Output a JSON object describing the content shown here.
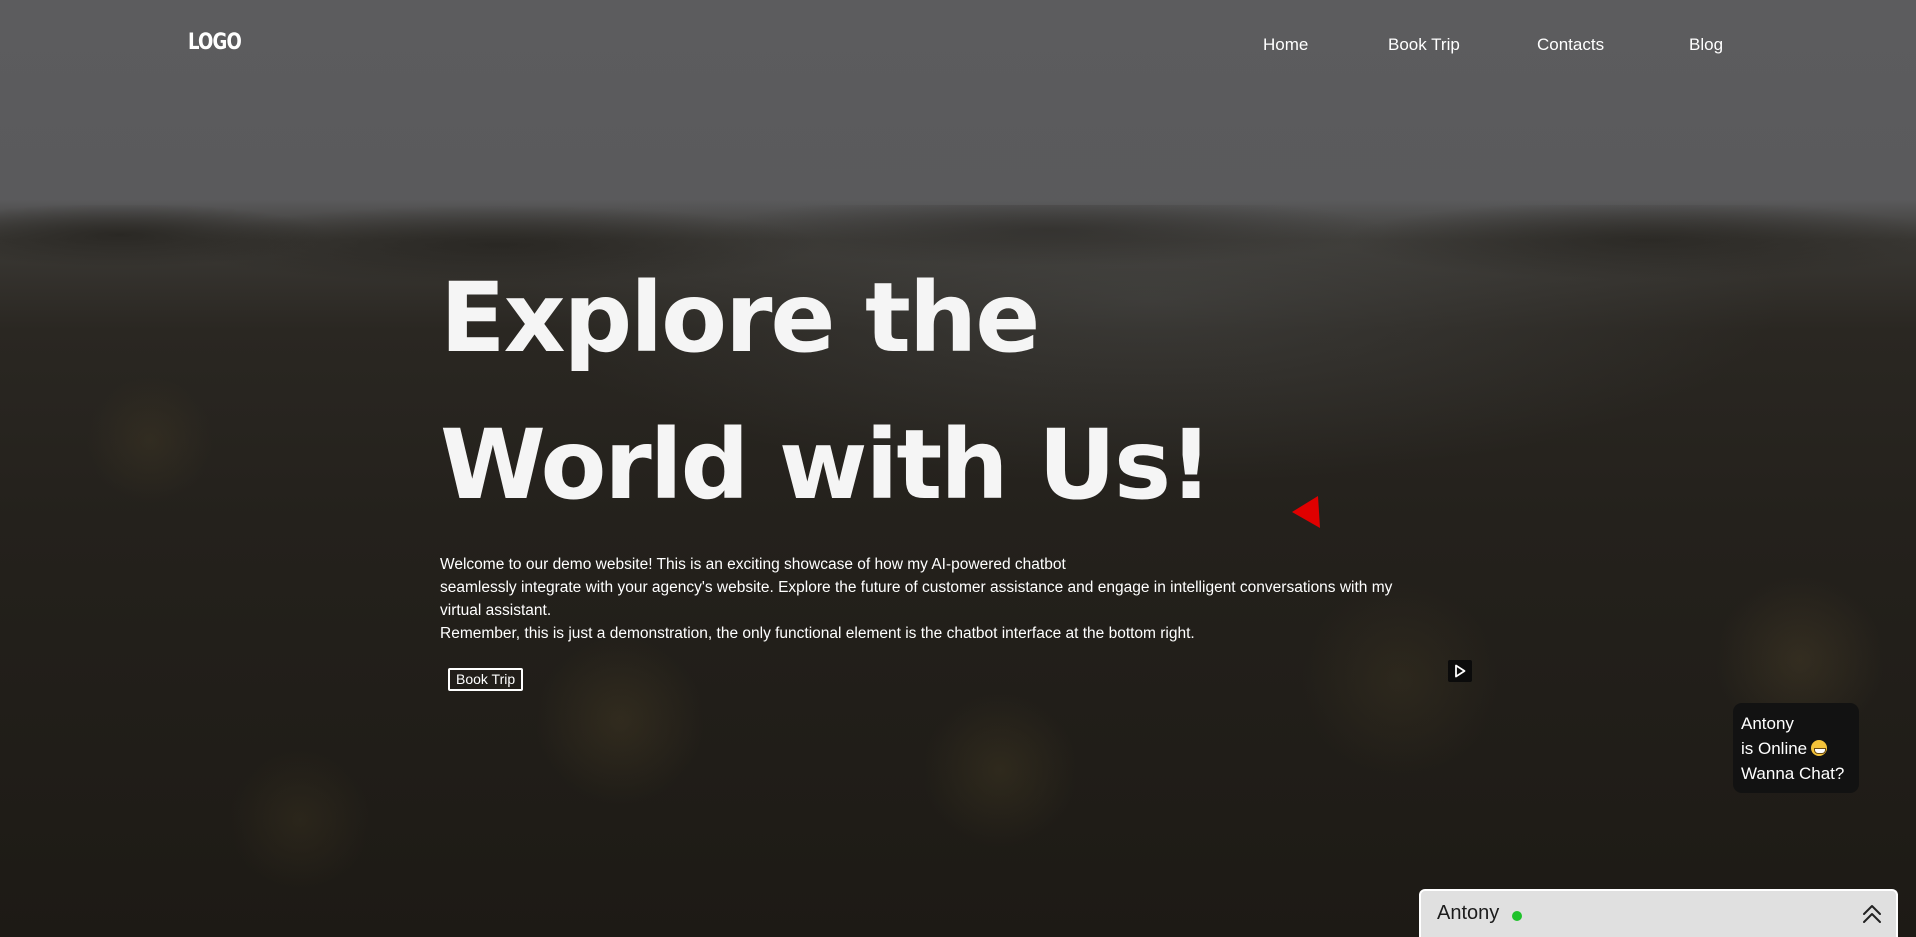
{
  "header": {
    "logo": "LOGO",
    "nav": [
      "Home",
      "Book Trip",
      "Contacts",
      "Blog"
    ]
  },
  "hero": {
    "title_lines": [
      "Explore the",
      "World with Us!"
    ],
    "text_lines": [
      "Welcome to our demo website! This is an exciting showcase of how my AI-powered chatbot",
      "seamlessly integrate with your agency's website. Explore the future of customer assistance and engage in intelligent conversations with my",
      "virtual assistant.",
      "Remember, this is just a demonstration, the only functional element is the chatbot interface at the bottom right."
    ],
    "cta_label": "Book Trip",
    "play_icon": "play-icon"
  },
  "chat": {
    "bubble_lines": [
      "Antony",
      "is Online",
      "Wanna Chat?"
    ],
    "bubble_emoji": "grinning-face-icon",
    "bar_name": "Antony",
    "status_color": "#1fc22b",
    "expand_icon": "double-chevron-up-icon"
  },
  "colors": {
    "text": "#ffffff",
    "chat_bar_bg": "#e0e0e0",
    "bubble_bg": "#121212",
    "pointer": "#e00000"
  }
}
